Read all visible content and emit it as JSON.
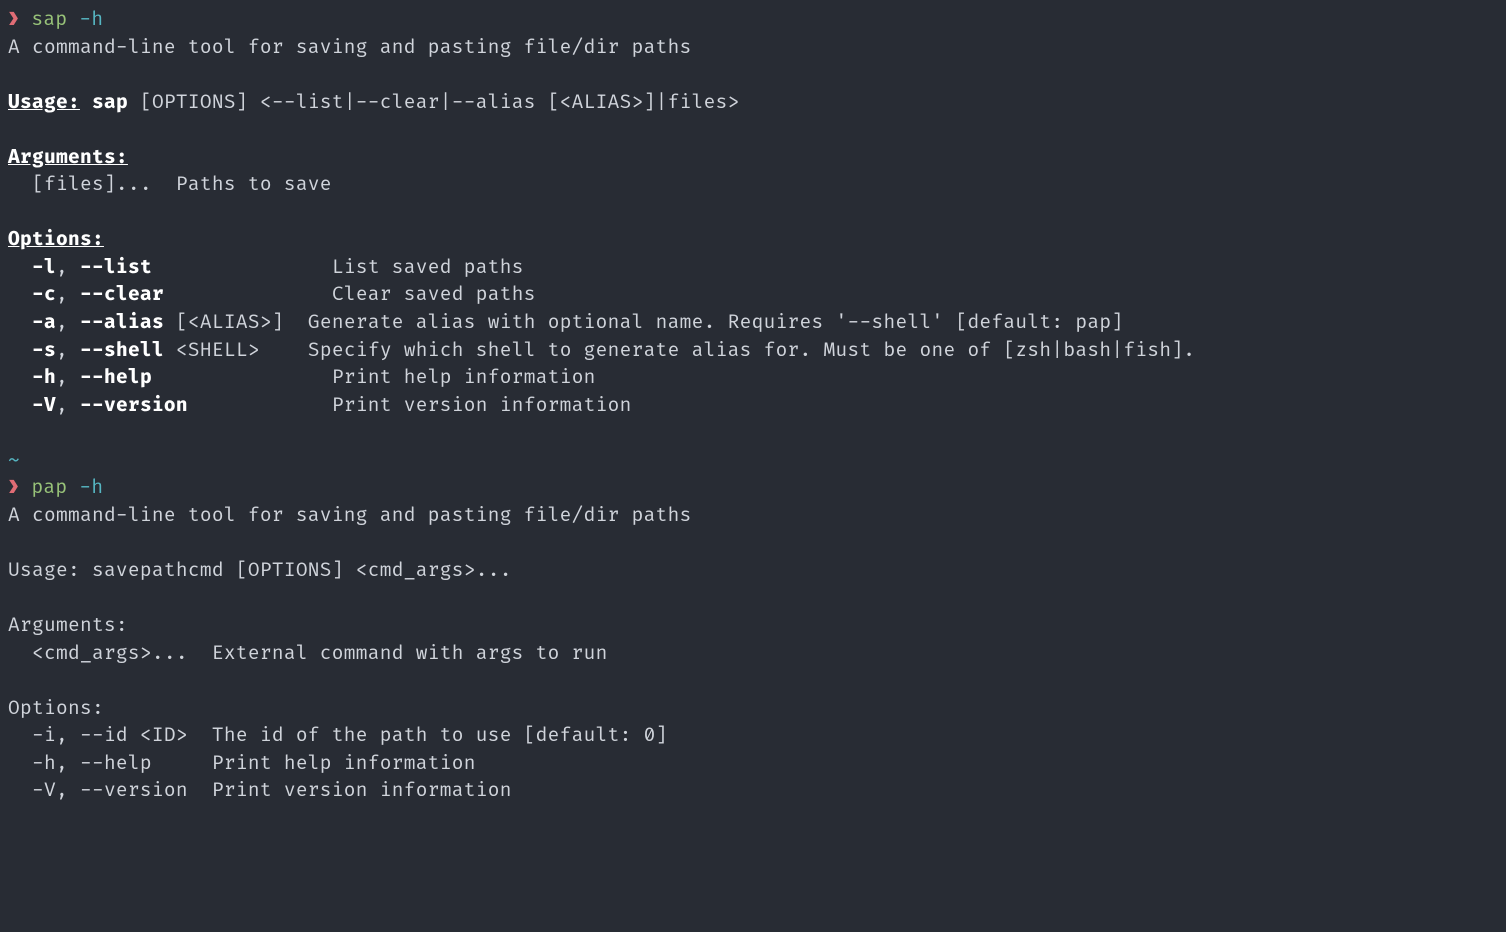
{
  "prompt1": {
    "arrow": "❯",
    "cmd": "sap",
    "flag": "-h"
  },
  "sap": {
    "description": "A command-line tool for saving and pasting file/dir paths",
    "usage_label": "Usage:",
    "usage_cmd": "sap",
    "usage_rest": " [OPTIONS] <--list|--clear|--alias [<ALIAS>]|files>",
    "arguments_label": "Arguments:",
    "arg_files": "  [files]...  Paths to save",
    "options_label": "Options:",
    "opt_list_short": "  -l",
    "opt_list_long": "--list",
    "opt_list_desc": "               List saved paths",
    "opt_clear_short": "  -c",
    "opt_clear_long": "--clear",
    "opt_clear_desc": "              Clear saved paths",
    "opt_alias_short": "  -a",
    "opt_alias_long": "--alias",
    "opt_alias_param": " [<ALIAS>]",
    "opt_alias_desc": "  Generate alias with optional name. Requires '--shell' [default: pap]",
    "opt_shell_short": "  -s",
    "opt_shell_long": "--shell",
    "opt_shell_param": " <SHELL>",
    "opt_shell_desc": "    Specify which shell to generate alias for. Must be one of [zsh|bash|fish].",
    "opt_help_short": "  -h",
    "opt_help_long": "--help",
    "opt_help_desc": "               Print help information",
    "opt_version_short": "  -V",
    "opt_version_long": "--version",
    "opt_version_desc": "            Print version information"
  },
  "cwd_indicator": "~",
  "prompt2": {
    "arrow": "❯",
    "cmd": "pap",
    "flag": "-h"
  },
  "pap": {
    "description": "A command-line tool for saving and pasting file/dir paths",
    "usage_line": "Usage: savepathcmd [OPTIONS] <cmd_args>...",
    "arguments_label": "Arguments:",
    "arg_cmd": "  <cmd_args>...  External command with args to run",
    "options_label": "Options:",
    "opt_id": "  -i, --id <ID>  The id of the path to use [default: 0]",
    "opt_help": "  -h, --help     Print help information",
    "opt_version": "  -V, --version  Print version information"
  },
  "sep": ", "
}
